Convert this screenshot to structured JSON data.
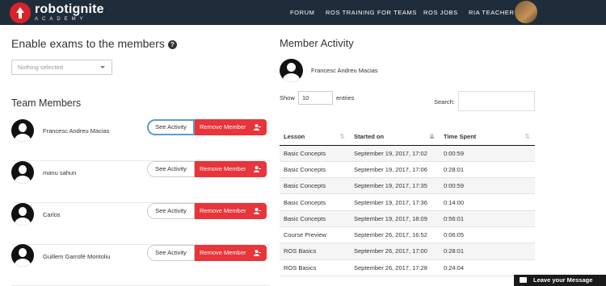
{
  "brand": {
    "name": "robotignite",
    "sub": "ACADEMY"
  },
  "nav": {
    "items": [
      "FORUM",
      "ROS TRAINING FOR TEAMS",
      "ROS JOBS",
      "RIA TEACHER"
    ]
  },
  "enable": {
    "title": "Enable exams to the members",
    "select_placeholder": "Nothing selected"
  },
  "team": {
    "title": "Team Members",
    "see_label": "See Activity",
    "remove_label": "Remove Member",
    "members": [
      "Francesc Andreu Macias",
      "manu sahun",
      "Carlos",
      "Guillem Garrofé Montoliu"
    ]
  },
  "activity": {
    "title": "Member Activity",
    "member_name": "Francesc Andreu Macias",
    "show_label": "Show",
    "entries_value": "10",
    "entries_label": "entries",
    "search_label": "Search:",
    "columns": [
      "Lesson",
      "Started on",
      "Time Spent"
    ],
    "rows": [
      [
        "Basic Concepts",
        "September 19, 2017, 17:02",
        "0:00:59"
      ],
      [
        "Basic Concepts",
        "September 19, 2017, 17:06",
        "0:28:01"
      ],
      [
        "Basic Concepts",
        "September 19, 2017, 17:35",
        "0:00:59"
      ],
      [
        "Basic Concepts",
        "September 19, 2017, 17:36",
        "0:14:00"
      ],
      [
        "Basic Concepts",
        "September 19, 2017, 18:09",
        "0:56:01"
      ],
      [
        "Course Preview",
        "September 26, 2017, 16:52",
        "0:06:05"
      ],
      [
        "ROS Basics",
        "September 26, 2017, 17:00",
        "0:28:01"
      ],
      [
        "ROS Basics",
        "September 26, 2017, 17:28",
        "0:24:04"
      ]
    ]
  },
  "chat": {
    "label": "Leave your Message"
  },
  "colors": {
    "topbar": "#1f2d3a",
    "accent_red": "#e8343a",
    "focus_blue": "#5b9bd5"
  }
}
